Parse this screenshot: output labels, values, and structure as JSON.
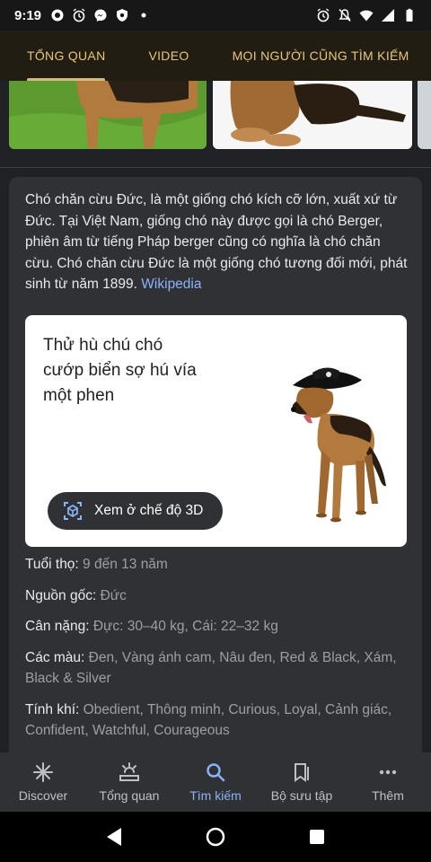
{
  "status": {
    "time": "9:19"
  },
  "tabs": [
    {
      "label": "TỔNG QUAN"
    },
    {
      "label": "VIDEO"
    },
    {
      "label": "MỌI NGƯỜI CŨNG TÌM KIẾM"
    }
  ],
  "description": {
    "text": "Chó chăn cừu Đức, là một giống chó kích cỡ lớn, xuất xứ từ Đức. Tại Việt Nam, giống chó này được gọi là chó Berger, phiên âm từ tiếng Pháp berger cũng có nghĩa là chó chăn cừu. Chó chăn cừu Đức là một giống chó tương đối mới, phát sinh từ năm 1899.",
    "source_link": "Wikipedia"
  },
  "promo": {
    "text": "Thử hù chú chó cướp biển sợ hú vía một phen",
    "button_label": "Xem ở chế độ 3D"
  },
  "facts": [
    {
      "key": "Tuổi thọ: ",
      "value": "9 đến 13 năm"
    },
    {
      "key": "Nguồn gốc: ",
      "value": "Đức",
      "is_link": true
    },
    {
      "key": "Cân nặng: ",
      "value": "Đực: 30–40 kg, Cái: 22–32 kg"
    },
    {
      "key": "Các màu: ",
      "value": "Đen, Vàng ánh cam, Nâu đen, Red & Black, Xám, Black & Silver"
    },
    {
      "key": "Tính khí: ",
      "value": "Obedient, Thông minh, Curious, Loyal, Cảnh giác, Confident, Watchful, Courageous"
    }
  ],
  "bottom_nav": [
    {
      "label": "Discover",
      "icon": "asterisk-icon"
    },
    {
      "label": "Tổng quan",
      "icon": "overview-icon"
    },
    {
      "label": "Tìm kiếm",
      "icon": "search-icon",
      "active": true
    },
    {
      "label": "Bộ sưu tập",
      "icon": "collections-icon"
    },
    {
      "label": "Thêm",
      "icon": "more-icon"
    }
  ],
  "colors": {
    "accent": "#8ab4f8",
    "tab_text": "#e6c77a",
    "background": "#202124",
    "card": "#303134"
  }
}
